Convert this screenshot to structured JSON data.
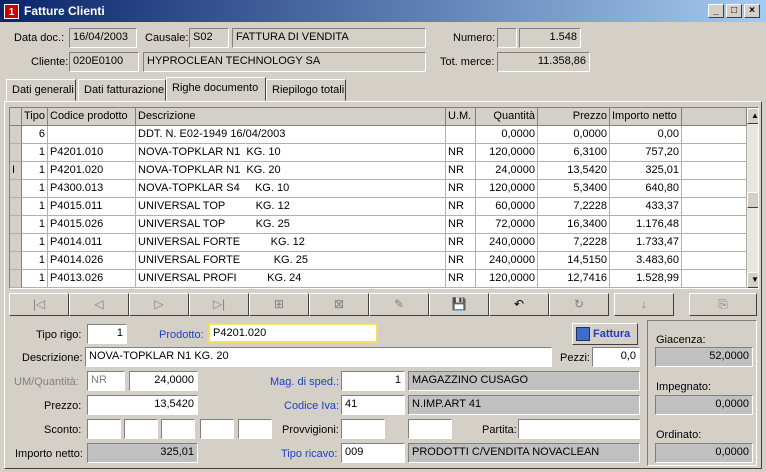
{
  "window": {
    "title": "Fatture Clienti",
    "icon_text": "1"
  },
  "header": {
    "data_doc_label": "Data doc.:",
    "data_doc": "16/04/2003",
    "causale_label": "Causale:",
    "causale_code": "S02",
    "causale_desc": "FATTURA DI VENDITA",
    "numero_label": "Numero:",
    "numero": "1.548",
    "cliente_label": "Cliente:",
    "cliente_code": "020E0100",
    "cliente_name": "HYPROCLEAN TECHNOLOGY SA",
    "tot_merce_label": "Tot. merce:",
    "tot_merce": "11.358,86"
  },
  "tabs": [
    "Dati generali",
    "Dati fatturazione",
    "Righe documento",
    "Riepilogo totali"
  ],
  "grid": {
    "columns": [
      "Tipo",
      "Codice prodotto",
      "Descrizione",
      "U.M.",
      "Quantità",
      "Prezzo",
      "Importo netto"
    ],
    "rows": [
      [
        "6",
        "",
        "DDT. N. E02-1949 16/04/2003",
        "",
        "0,0000",
        "0,0000",
        "0,00"
      ],
      [
        "1",
        "P4201.010",
        "NOVA-TOPKLAR N1  KG. 10",
        "NR",
        "120,0000",
        "6,3100",
        "757,20"
      ],
      [
        "1",
        "P4201.020",
        "NOVA-TOPKLAR N1  KG. 20",
        "NR",
        "24,0000",
        "13,5420",
        "325,01"
      ],
      [
        "1",
        "P4300.013",
        "NOVA-TOPKLAR S4     KG. 10",
        "NR",
        "120,0000",
        "5,3400",
        "640,80"
      ],
      [
        "1",
        "P4015.011",
        "UNIVERSAL TOP          KG. 12",
        "NR",
        "60,0000",
        "7,2228",
        "433,37"
      ],
      [
        "1",
        "P4015.026",
        "UNIVERSAL TOP          KG. 25",
        "NR",
        "72,0000",
        "16,3400",
        "1.176,48"
      ],
      [
        "1",
        "P4014.011",
        "UNIVERSAL FORTE          KG. 12",
        "NR",
        "240,0000",
        "7,2228",
        "1.733,47"
      ],
      [
        "1",
        "P4014.026",
        "UNIVERSAL FORTE           KG. 25",
        "NR",
        "240,0000",
        "14,5150",
        "3.483,60"
      ],
      [
        "1",
        "P4013.026",
        "UNIVERSAL PROFI          KG. 24",
        "NR",
        "120,0000",
        "12,7416",
        "1.528,99"
      ]
    ],
    "current_row_marker": "I"
  },
  "toolbar": {
    "first": "|◁",
    "prev": "◁",
    "next": "▷",
    "last": "▷|",
    "insert": "⊞",
    "delete": "⊠",
    "edit": "✎",
    "save": "💾",
    "undo": "↶",
    "refresh": "↻",
    "sort": "↓",
    "copy": "⎘"
  },
  "detail": {
    "tipo_rigo_label": "Tipo rigo:",
    "tipo_rigo": "1",
    "prodotto_label": "Prodotto:",
    "prodotto": "P4201.020",
    "fattura_button": "Fattura",
    "descrizione_label": "Descrizione:",
    "descrizione": "NOVA-TOPKLAR N1  KG. 20",
    "pezzi_label": "Pezzi:",
    "pezzi": "0,0",
    "um_qta_label": "UM/Quantità:",
    "um": "NR",
    "quantita": "24,0000",
    "mag_label": "Mag. di sped.:",
    "mag_code": "1",
    "mag_desc": "MAGAZZINO CUSAGO",
    "prezzo_label": "Prezzo:",
    "prezzo": "13,5420",
    "iva_label": "Codice Iva:",
    "iva_code": "41",
    "iva_desc": "N.IMP.ART 41",
    "sconto_label": "Sconto:",
    "provvigioni_label": "Provvigioni:",
    "partita_label": "Partita:",
    "importo_label": "Importo netto:",
    "importo": "325,01",
    "ricavo_label": "Tipo ricavo:",
    "ricavo_code": "009",
    "ricavo_desc": "PRODOTTI  C/VENDITA NOVACLEAN"
  },
  "stock": {
    "giacenza_label": "Giacenza:",
    "giacenza": "52,0000",
    "impegnato_label": "Impegnato:",
    "impegnato": "0,0000",
    "ordinato_label": "Ordinato:",
    "ordinato": "0,0000"
  }
}
